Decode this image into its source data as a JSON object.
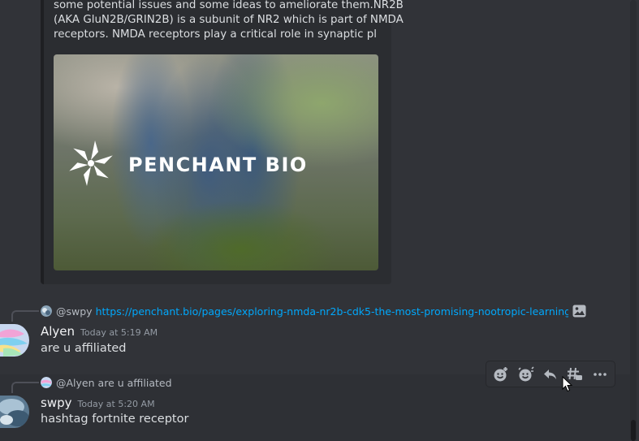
{
  "embed": {
    "description_lines": [
      "some potential issues and some ideas to ameliorate them.NR2B",
      "(AKA GluN2B/GRIN2B) is a subunit of NR2 which is part of NMDA",
      "receptors. NMDA receptors play a critical role in synaptic pl"
    ],
    "image_brand_text": "PENCHANT BIO"
  },
  "messages": [
    {
      "reply": {
        "author": "@swpy",
        "text": "https://penchant.bio/pages/exploring-nmda-nr2b-cdk5-the-most-promising-nootropic-learning-p",
        "attachment_icon": "image-icon"
      },
      "author": "Alyen",
      "timestamp": "Today at 5:19 AM",
      "content": "are u affiliated"
    },
    {
      "reply": {
        "author": "@Alyen",
        "text": "are u affiliated"
      },
      "author": "swpy",
      "timestamp": "Today at 5:20 AM",
      "content": "hashtag fortnite receptor"
    }
  ],
  "toolbar": {
    "buttons": [
      "add-reaction-icon",
      "super-reaction-icon",
      "reply-icon",
      "create-thread-icon",
      "more-icon"
    ]
  },
  "colors": {
    "background": "#313338",
    "link": "#00a8fc",
    "username": "#f2f3f5",
    "timestamp": "#949ba4"
  }
}
